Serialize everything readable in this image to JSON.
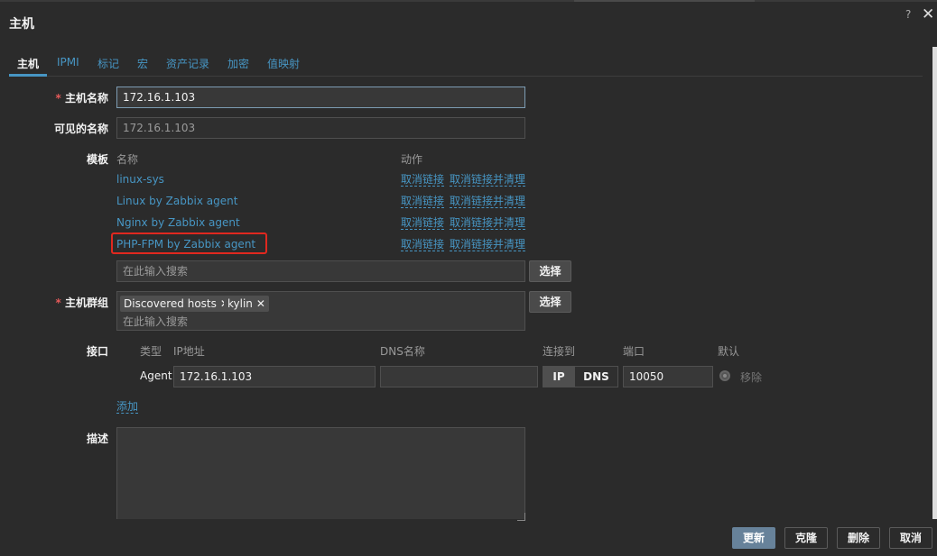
{
  "dialog": {
    "title": "主机",
    "help_icon": "?",
    "close_icon": "✕"
  },
  "tabs": [
    {
      "label": "主机",
      "active": true
    },
    {
      "label": "IPMI"
    },
    {
      "label": "标记"
    },
    {
      "label": "宏"
    },
    {
      "label": "资产记录"
    },
    {
      "label": "加密"
    },
    {
      "label": "值映射"
    }
  ],
  "form": {
    "required_mark": "*",
    "host_name": {
      "label": "主机名称",
      "value": "172.16.1.103"
    },
    "visible_name": {
      "label": "可见的名称",
      "placeholder": "172.16.1.103"
    },
    "templates": {
      "label": "模板",
      "col_name": "名称",
      "col_action": "动作",
      "items": [
        {
          "name": "linux-sys",
          "unlink": "取消链接",
          "unlink_clear": "取消链接并清理"
        },
        {
          "name": "Linux by Zabbix agent",
          "unlink": "取消链接",
          "unlink_clear": "取消链接并清理"
        },
        {
          "name": "Nginx by Zabbix agent",
          "unlink": "取消链接",
          "unlink_clear": "取消链接并清理"
        },
        {
          "name": "PHP-FPM by Zabbix agent",
          "unlink": "取消链接",
          "unlink_clear": "取消链接并清理",
          "highlighted": true
        }
      ],
      "search_placeholder": "在此输入搜索",
      "select_button": "选择"
    },
    "host_groups": {
      "label": "主机群组",
      "chips": [
        {
          "label": "Discovered hosts",
          "remove": "✕"
        },
        {
          "label": "kylin",
          "remove": "✕"
        }
      ],
      "search_placeholder": "在此输入搜索",
      "select_button": "选择"
    },
    "interfaces": {
      "label": "接口",
      "headers": {
        "type": "类型",
        "ip": "IP地址",
        "dns": "DNS名称",
        "connect": "连接到",
        "port": "端口",
        "default": "默认"
      },
      "row": {
        "type": "Agent",
        "ip": "172.16.1.103",
        "dns": "",
        "ip_btn": "IP",
        "dns_btn": "DNS",
        "connect_selected": "IP",
        "port": "10050",
        "remove": "移除"
      },
      "add": "添加"
    },
    "description": {
      "label": "描述",
      "value": ""
    }
  },
  "footer": {
    "update": "更新",
    "clone": "克隆",
    "delete": "删除",
    "cancel": "取消"
  },
  "colors": {
    "accent": "#4796c4",
    "required": "#e45959",
    "highlight_border": "#e0281f",
    "primary_button": "#67829a"
  }
}
